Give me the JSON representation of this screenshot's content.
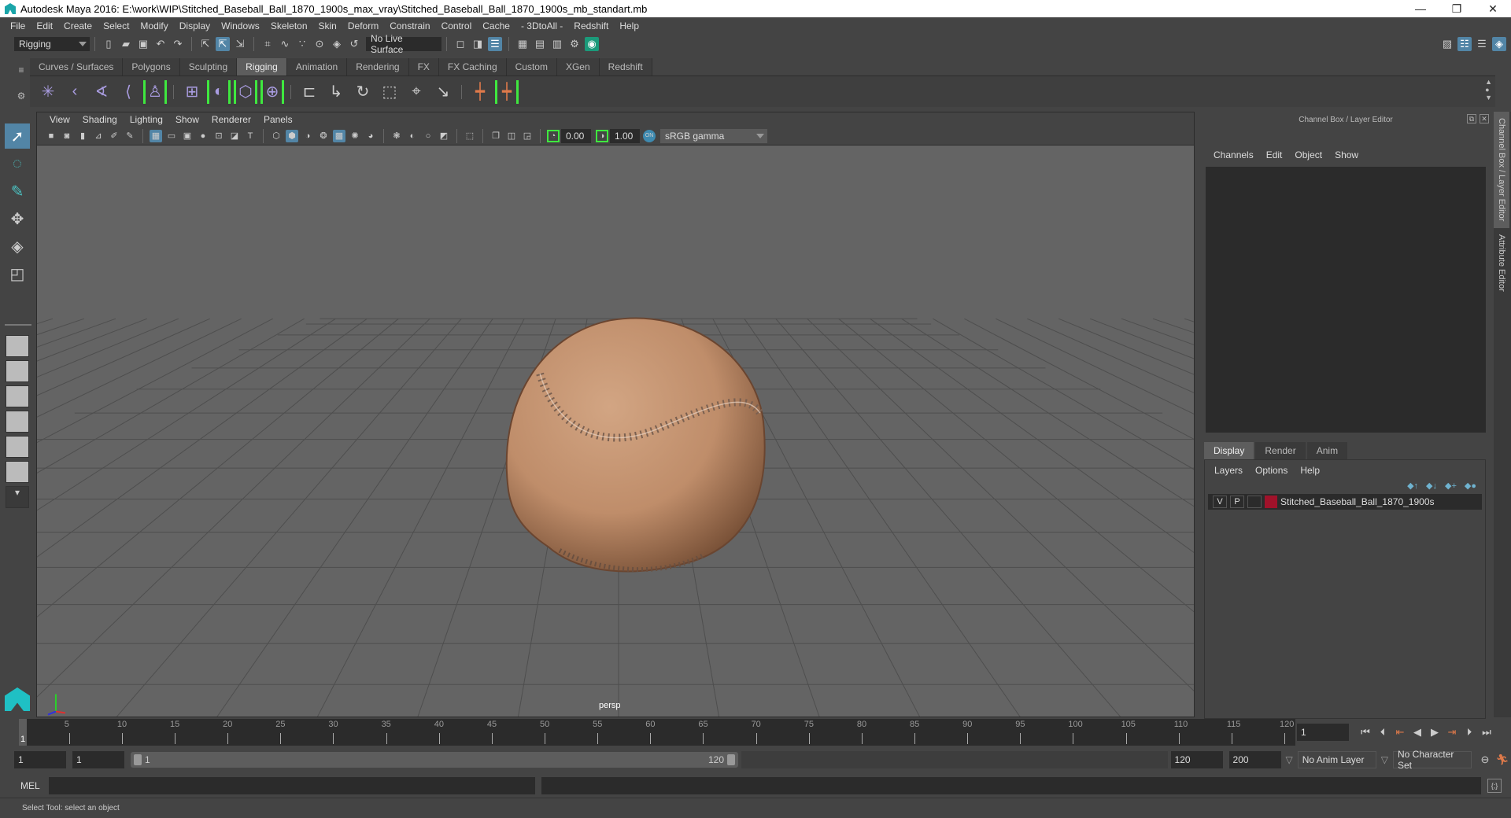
{
  "window": {
    "title": "Autodesk Maya 2016: E:\\work\\WIP\\Stitched_Baseball_Ball_1870_1900s_max_vray\\Stitched_Baseball_Ball_1870_1900s_mb_standart.mb",
    "minimize": "—",
    "restore": "❐",
    "close": "✕"
  },
  "menubar": [
    "File",
    "Edit",
    "Create",
    "Select",
    "Modify",
    "Display",
    "Windows",
    "Skeleton",
    "Skin",
    "Deform",
    "Constrain",
    "Control",
    "Cache",
    "- 3DtoAll -",
    "Redshift",
    "Help"
  ],
  "statusline": {
    "menuset": "Rigging",
    "live_surface": "No Live Surface"
  },
  "shelf": {
    "tabs": [
      "Curves / Surfaces",
      "Polygons",
      "Sculpting",
      "Rigging",
      "Animation",
      "Rendering",
      "FX",
      "FX Caching",
      "Custom",
      "XGen",
      "Redshift"
    ],
    "active_tab": "Rigging"
  },
  "viewport": {
    "menu": [
      "View",
      "Shading",
      "Lighting",
      "Show",
      "Renderer",
      "Panels"
    ],
    "exposure": "0.00",
    "gamma": "1.00",
    "color_space": "sRGB gamma",
    "camera_label": "persp",
    "axis": {
      "x": "x",
      "y": "y",
      "z": "z"
    }
  },
  "right_panel": {
    "title": "Channel Box / Layer Editor",
    "menu": [
      "Channels",
      "Edit",
      "Object",
      "Show"
    ],
    "layer_tabs": [
      "Display",
      "Render",
      "Anim"
    ],
    "active_layer_tab": "Display",
    "layer_menu": [
      "Layers",
      "Options",
      "Help"
    ],
    "layers": [
      {
        "visible": "V",
        "playback": "P",
        "name": "Stitched_Baseball_Ball_1870_1900s",
        "color": "#a0122a"
      }
    ]
  },
  "side_tabs": [
    "Channel Box / Layer Editor",
    "Attribute Editor"
  ],
  "timeline": {
    "start": 1,
    "end": 120,
    "current_frame": "1",
    "ticks": [
      5,
      10,
      15,
      20,
      25,
      30,
      35,
      40,
      45,
      50,
      55,
      60,
      65,
      70,
      75,
      80,
      85,
      90,
      95,
      100,
      105,
      110,
      115,
      120
    ]
  },
  "range": {
    "start_field": "1",
    "playback_start": "1",
    "slider_start": "1",
    "slider_end": "120",
    "playback_end": "120",
    "end_field": "200",
    "anim_layer": "No Anim Layer",
    "character_set": "No Character Set"
  },
  "command_line": {
    "label": "MEL",
    "value": ""
  },
  "status": {
    "help_text": "Select Tool: select an object"
  }
}
